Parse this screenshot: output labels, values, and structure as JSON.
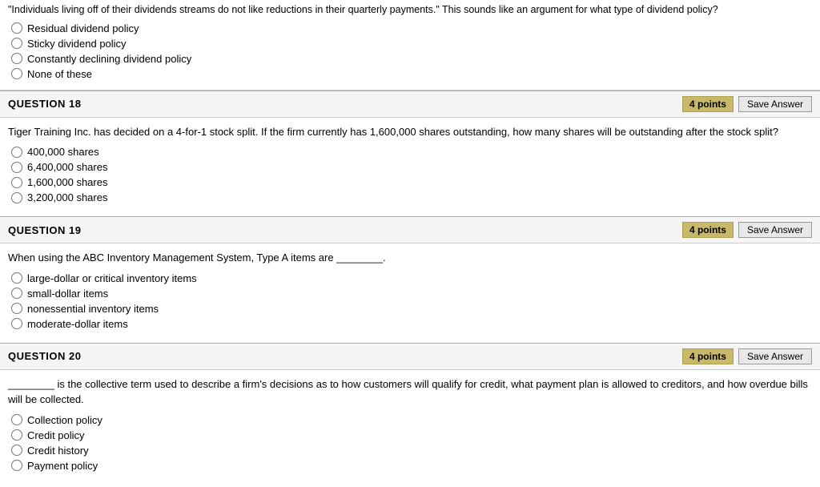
{
  "topPartial": {
    "questionText": "\"Individuals living off of their dividends streams do not like reductions in their quarterly payments.\" This sounds like an argument for what type of dividend policy?",
    "options": [
      "Residual dividend policy",
      "Sticky dividend policy",
      "Constantly declining dividend policy",
      "None of these"
    ]
  },
  "questions": [
    {
      "id": "q18",
      "number": "QUESTION 18",
      "points": "4 points",
      "saveLabel": "Save Answer",
      "text": "Tiger Training Inc. has decided on a 4-for-1 stock split. If the firm currently has 1,600,000 shares outstanding, how many shares will be outstanding after the stock split?",
      "options": [
        "400,000 shares",
        "6,400,000 shares",
        "1,600,000 shares",
        "3,200,000 shares"
      ]
    },
    {
      "id": "q19",
      "number": "QUESTION 19",
      "points": "4 points",
      "saveLabel": "Save Answer",
      "text": "When using the ABC Inventory Management System, Type A items are ________.",
      "options": [
        "large-dollar or critical inventory items",
        "small-dollar items",
        "nonessential inventory items",
        "moderate-dollar items"
      ]
    },
    {
      "id": "q20",
      "number": "QUESTION 20",
      "points": "4 points",
      "saveLabel": "Save Answer",
      "text": "________ is the collective term used to describe a firm's decisions as to how customers will qualify for credit, what payment plan is allowed to creditors, and how overdue bills will be collected.",
      "options": [
        "Collection policy",
        "Credit policy",
        "Credit history",
        "Payment policy"
      ]
    }
  ]
}
